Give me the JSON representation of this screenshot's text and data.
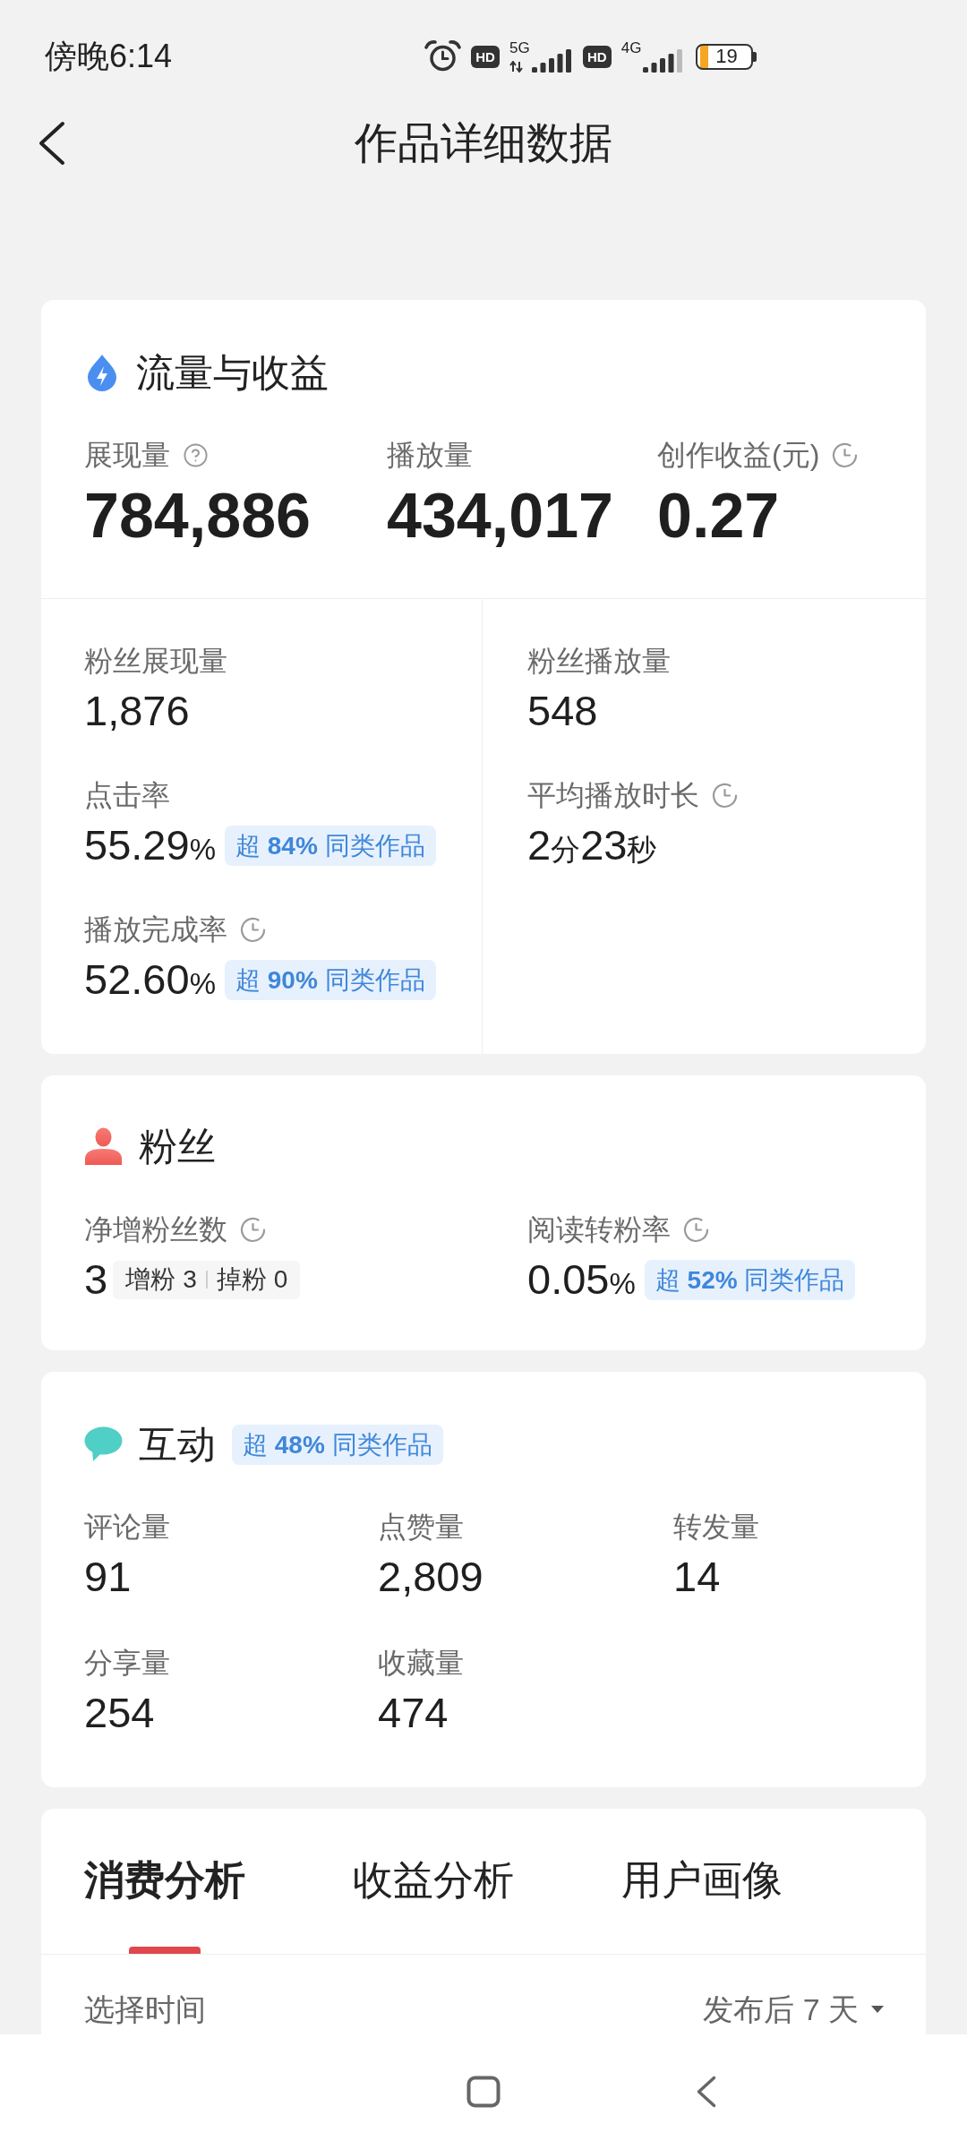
{
  "status_bar": {
    "time": "傍晚6:14",
    "sims": [
      {
        "hd": "HD",
        "network": "5G",
        "arrows": true
      },
      {
        "hd": "HD",
        "network": "4G",
        "arrows": false
      }
    ],
    "battery": "19"
  },
  "header": {
    "title": "作品详细数据"
  },
  "traffic_card": {
    "title": "流量与收益",
    "main_metrics": [
      {
        "label": "展现量",
        "kind": "help",
        "value": "784,886"
      },
      {
        "label": "播放量",
        "kind": "plain",
        "value": "434,017"
      },
      {
        "label": "创作收益(元)",
        "kind": "timed",
        "value": "0.27"
      }
    ],
    "left_metrics": [
      {
        "label": "粉丝展现量",
        "kind": "plain",
        "value": "1,876"
      },
      {
        "label": "点击率",
        "kind": "plain",
        "value": "55.29%",
        "badge": "超 **84%** 同类作品"
      },
      {
        "label": "播放完成率",
        "kind": "timed",
        "value": "52.60%",
        "badge": "超 **90%** 同类作品"
      }
    ],
    "right_metrics": [
      {
        "label": "粉丝播放量",
        "kind": "plain",
        "value": "548"
      },
      {
        "label": "平均播放时长",
        "kind": "timed",
        "value": "2分23秒"
      }
    ]
  },
  "fans_card": {
    "title": "粉丝",
    "metrics": [
      {
        "label": "净增粉丝数",
        "kind": "timed",
        "value": "3",
        "breakdown": [
          {
            "label": "增粉",
            "value": "3"
          },
          {
            "label": "掉粉",
            "value": "0"
          }
        ]
      },
      {
        "label": "阅读转粉率",
        "kind": "timed",
        "value": "0.05%",
        "badge": "超 **52%** 同类作品"
      }
    ]
  },
  "interaction_card": {
    "title": "互动",
    "badge": "超 **48%** 同类作品",
    "metrics": [
      {
        "label": "评论量",
        "value": "91"
      },
      {
        "label": "点赞量",
        "value": "2,809"
      },
      {
        "label": "转发量",
        "value": "14"
      },
      {
        "label": "分享量",
        "value": "254"
      },
      {
        "label": "收藏量",
        "value": "474"
      }
    ]
  },
  "analysis_card": {
    "tabs": [
      {
        "label": "消费分析",
        "selected": true
      },
      {
        "label": "收益分析",
        "selected": false
      },
      {
        "label": "用户画像",
        "selected": false
      }
    ],
    "filter": {
      "label": "选择时间",
      "value": "发布后 7 天"
    }
  }
}
